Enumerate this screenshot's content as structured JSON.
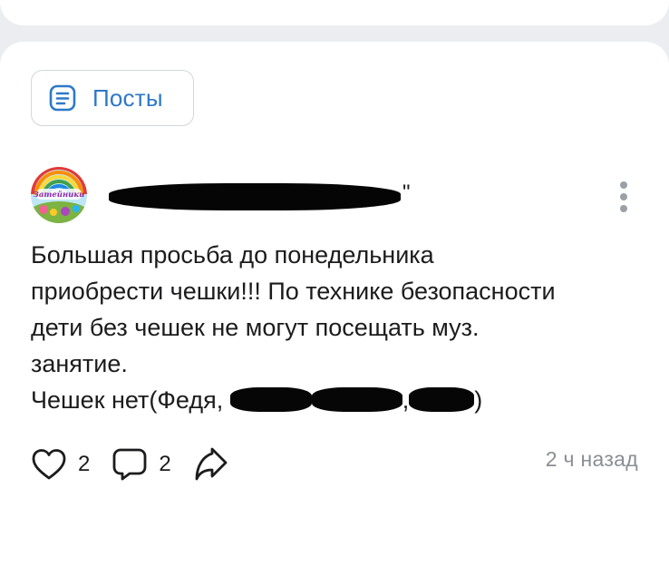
{
  "tabs": {
    "posts_label": "Посты"
  },
  "post": {
    "author_visible_suffix": "\"",
    "text_lines": [
      "Большая просьба до понедельника",
      "приобрести чешки!!! По технике безопасности",
      "дети без чешек не могут посещать муз.",
      "занятие."
    ],
    "missing_prefix": "Чешек нет(Федя,",
    "missing_sep1": ",",
    "missing_sep2": ",",
    "missing_suffix": ")",
    "avatar_text": "Затейники",
    "likes": "2",
    "comments": "2",
    "timestamp": "2 ч назад"
  },
  "colors": {
    "accent": "#2d79c8",
    "text": "#1c1c1e",
    "muted": "#8a8d92",
    "background": "#ebedf0"
  },
  "icons": {
    "posts_tab": "document-lines-icon",
    "menu": "kebab-menu-icon",
    "like": "heart-outline-icon",
    "comment": "speech-bubble-icon",
    "share": "share-arrow-icon"
  }
}
